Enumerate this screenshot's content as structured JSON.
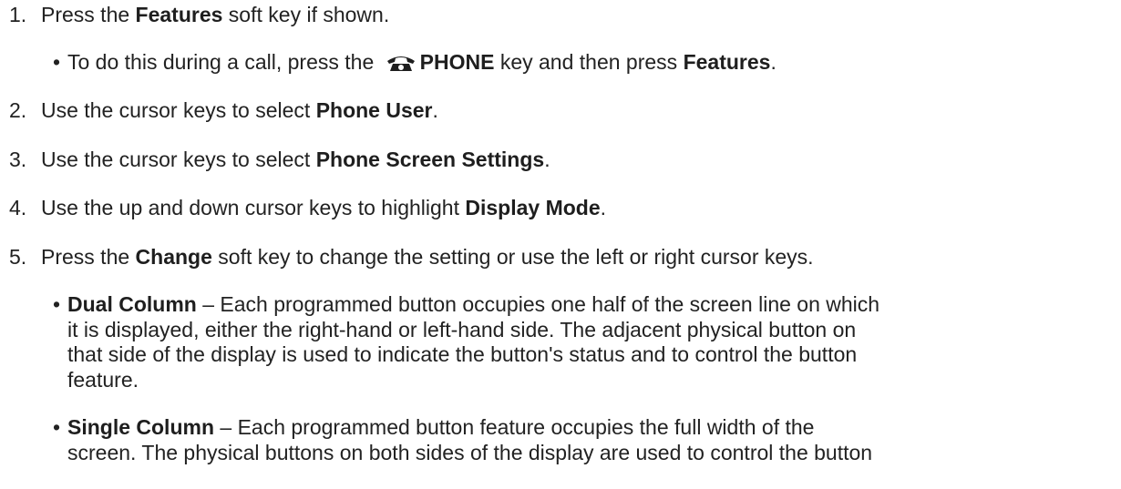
{
  "steps": [
    {
      "num": "1.",
      "parts": [
        "Press the ",
        "Features",
        " soft key if shown."
      ]
    },
    {
      "num": "2.",
      "parts": [
        "Use the cursor keys to select ",
        "Phone User",
        "."
      ]
    },
    {
      "num": "3.",
      "parts": [
        "Use the cursor keys to select ",
        "Phone Screen Settings",
        "."
      ]
    },
    {
      "num": "4.",
      "parts": [
        "Use the up and down cursor keys to highlight ",
        "Display Mode",
        "."
      ]
    },
    {
      "num": "5.",
      "parts": [
        "Press the ",
        "Change",
        " soft key to change the setting or use the left or right cursor keys."
      ]
    }
  ],
  "step1_sub": {
    "pre": "To do this during a call, press the ",
    "icon": "phone-icon",
    "key": "PHONE",
    "mid": " key and then press ",
    "bold": "Features",
    "post": "."
  },
  "dual_column": {
    "term": "Dual Column",
    "lines": [
      " – Each programmed button occupies one half of the screen line on which",
      "it is displayed, either the right-hand or left-hand side. The adjacent physical button on",
      "that side of the display is used to indicate the button's status and to control the button",
      "feature."
    ]
  },
  "single_column": {
    "term": "Single Column",
    "lines": [
      " – Each programmed button feature occupies the full width of the",
      "screen. The physical buttons on both sides of the display are used to control the button"
    ]
  },
  "bullet_char": "•"
}
